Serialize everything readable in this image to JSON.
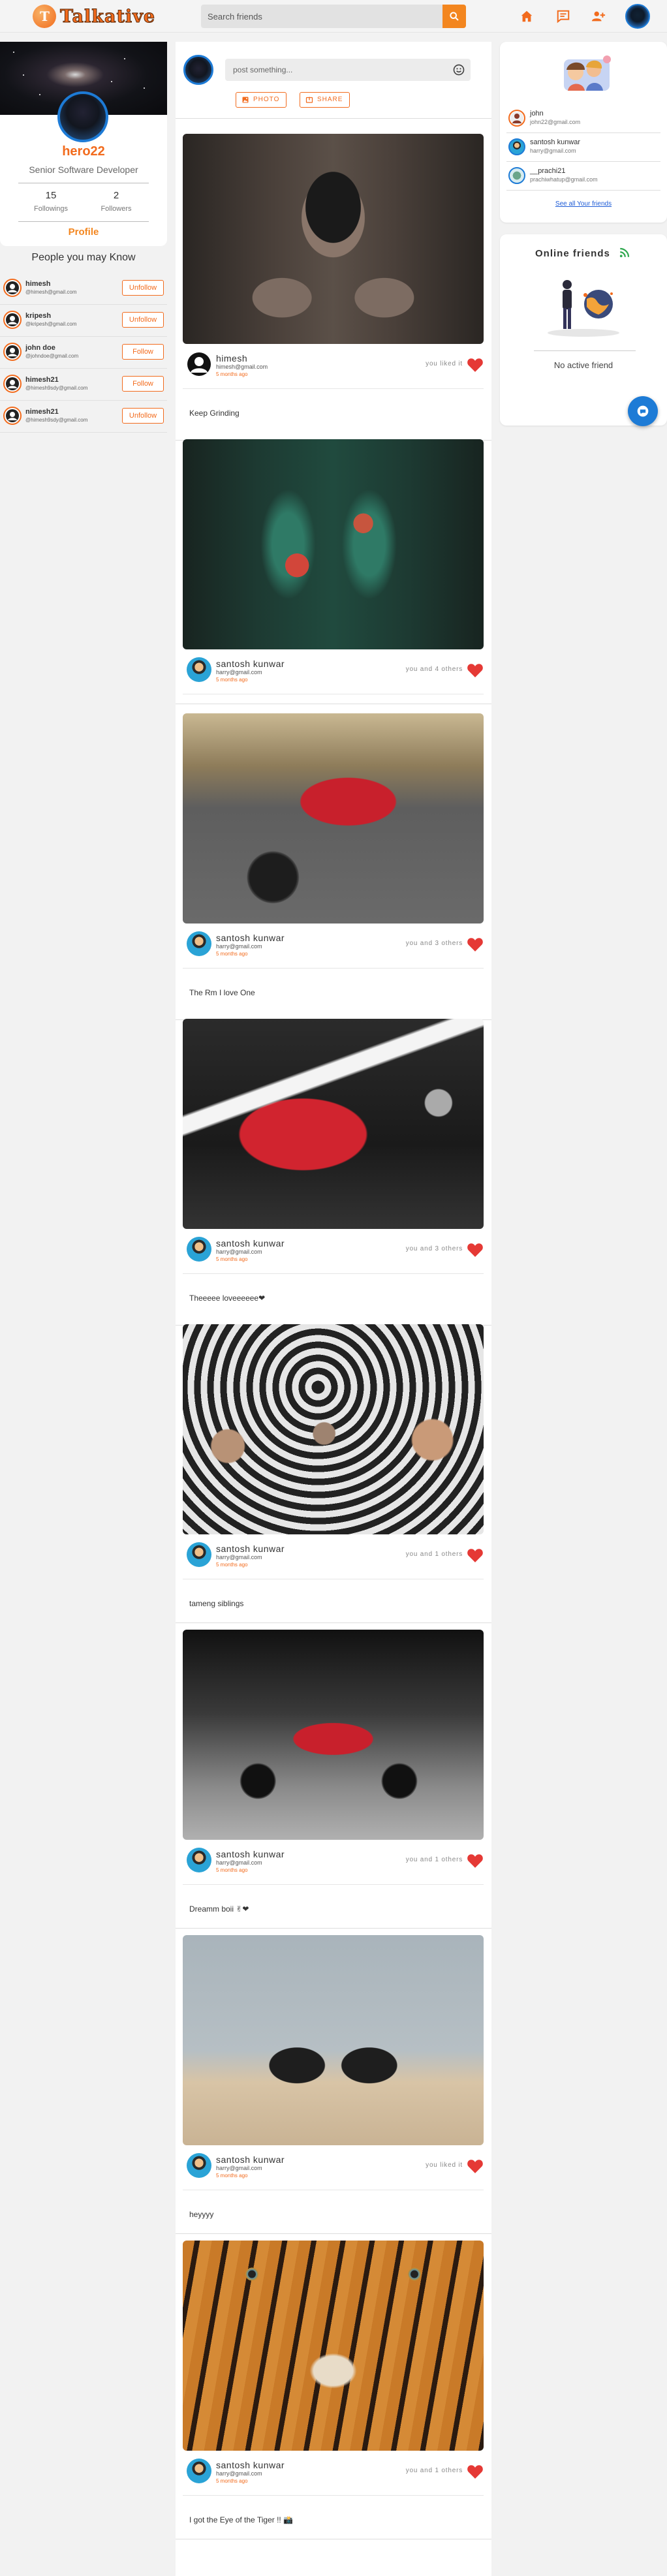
{
  "app": {
    "logo_text": "Talkative"
  },
  "navbar": {
    "search_placeholder": "Search friends",
    "icons": [
      "home-icon",
      "message-icon",
      "add-friend-icon"
    ]
  },
  "profile": {
    "username": "hero22",
    "title": "Senior Software Developer",
    "followings_count": "15",
    "followings_label": "Followings",
    "followers_count": "2",
    "followers_label": "Followers",
    "profile_link": "Profile"
  },
  "people_you_may_know": {
    "title": "People you may Know",
    "items": [
      {
        "name": "himesh",
        "email": "@himesh@gmail.com",
        "action": "Unfollow"
      },
      {
        "name": "kripesh",
        "email": "@kripesh@gmail.com",
        "action": "Unfollow"
      },
      {
        "name": "john doe",
        "email": "@johndoe@gmail.com",
        "action": "Follow"
      },
      {
        "name": "himesh21",
        "email": "@himesh9sdy@gmail.com",
        "action": "Follow"
      },
      {
        "name": "nimesh21",
        "email": "@himesh9sdy@gmail.com",
        "action": "Unfollow"
      }
    ]
  },
  "composer": {
    "placeholder": "post something...",
    "photo_label": "PHOTO",
    "share_label": "SHARE"
  },
  "posts": [
    {
      "name": "himesh",
      "email": "himesh@gmail.com",
      "time": "5 months ago",
      "likes": "you liked it",
      "caption": "Keep Grinding"
    },
    {
      "name": "santosh kunwar",
      "email": "harry@gmail.com",
      "time": "5 months ago",
      "likes": "you and 4 others",
      "caption": ""
    },
    {
      "name": "santosh kunwar",
      "email": "harry@gmail.com",
      "time": "5 months ago",
      "likes": "you and 3 others",
      "caption": "The Rm I love One"
    },
    {
      "name": "santosh kunwar",
      "email": "harry@gmail.com",
      "time": "5 months ago",
      "likes": "you and 3 others",
      "caption": "Theeeee loveeeeee❤"
    },
    {
      "name": "santosh kunwar",
      "email": "harry@gmail.com",
      "time": "5 months ago",
      "likes": "you and 1 others",
      "caption": "tameng siblings"
    },
    {
      "name": "santosh kunwar",
      "email": "harry@gmail.com",
      "time": "5 months ago",
      "likes": "you and 1 others",
      "caption": "Dreamm boii ✌❤"
    },
    {
      "name": "santosh kunwar",
      "email": "harry@gmail.com",
      "time": "5 months ago",
      "likes": "you liked it",
      "caption": "heyyyy"
    },
    {
      "name": "santosh kunwar",
      "email": "harry@gmail.com",
      "time": "5 months ago",
      "likes": "you and 1 others",
      "caption": "I got the Eye of the Tiger !! 📸"
    }
  ],
  "friends": {
    "items": [
      {
        "name": "john",
        "email": "john22@gmail.com"
      },
      {
        "name": "santosh kunwar",
        "email": "harry@gmail.com"
      },
      {
        "name": "__prachi21",
        "email": "prachiwhatup@gmail.com"
      }
    ],
    "see_all": "See all Your friends"
  },
  "online": {
    "title": "Online friends",
    "empty_text": "No active friend"
  },
  "colors": {
    "accent": "#f26b1d",
    "orange_button": "#f3861f",
    "blue": "#1d7bd6",
    "heart": "#e53935"
  }
}
